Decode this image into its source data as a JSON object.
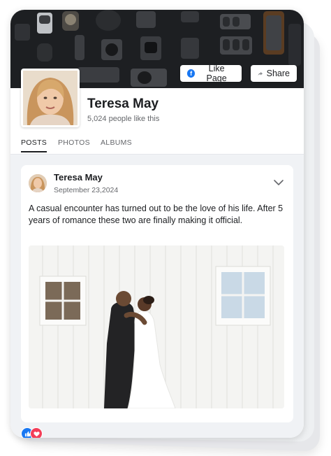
{
  "cover": {
    "like_button_label": "Like Page",
    "share_button_label": "Share",
    "facebook_icon_glyph": "f",
    "icons": [
      "facebook-icon",
      "share-arrow-icon"
    ],
    "background_color": "#1d1f22"
  },
  "page": {
    "name": "Teresa May",
    "likes_text": "5,024 people like this"
  },
  "tabs": [
    {
      "label": "POSTS",
      "active": true
    },
    {
      "label": "PHOTOS",
      "active": false
    },
    {
      "label": "ALBUMS",
      "active": false
    }
  ],
  "post": {
    "author": "Teresa May",
    "date": "September 23,2024",
    "text": "A casual encounter has turned out to be the love of his life. After 5 years of romance these two are finally making it official.",
    "icons": [
      "chevron-down-icon"
    ]
  },
  "reactions": {
    "types": [
      "like-reaction-icon",
      "love-reaction-icon"
    ],
    "like_color": "#1877f2",
    "love_color": "#f33e58"
  },
  "colors": {
    "accent": "#1877f2",
    "feed_background": "#f0f2f5",
    "secondary_text": "#65676b"
  }
}
